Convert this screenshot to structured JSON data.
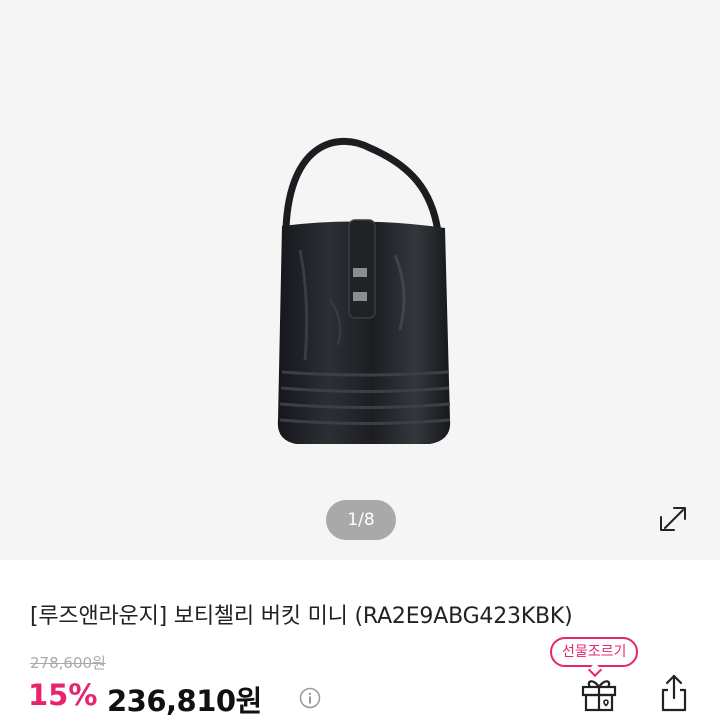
{
  "gallery": {
    "pager": "1/8",
    "image_icon": "handbag-image",
    "expand_icon": "expand-icon"
  },
  "product": {
    "title": "[루즈앤라운지] 보티첼리 버킷 미니 (RA2E9ABG423KBK)",
    "original_price": "278,600원",
    "discount": "15%",
    "sale_price": "236,810원",
    "info_icon": "info-icon"
  },
  "actions": {
    "gift_badge": "선물조르기",
    "gift_icon": "gift-icon",
    "share_icon": "share-icon"
  },
  "colors": {
    "accent": "#e8246f",
    "gallery_bg": "#f5f5f5",
    "pager_bg": "#a9a9a9"
  }
}
